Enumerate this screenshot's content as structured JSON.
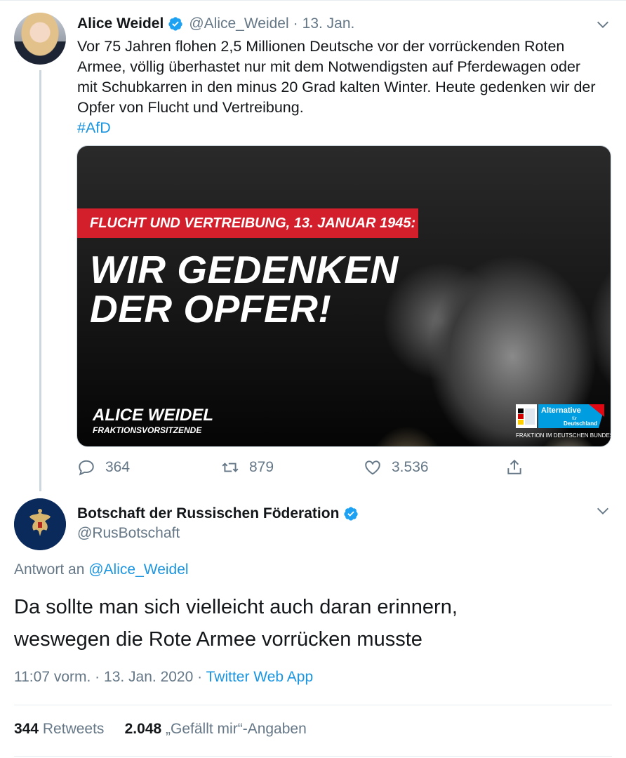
{
  "tweet1": {
    "name": "Alice Weidel",
    "handle": "@Alice_Weidel",
    "separator": "·",
    "date": "13. Jan.",
    "text": "Vor 75 Jahren flohen 2,5 Millionen Deutsche vor der vorrückenden Roten Armee, völlig überhastet nur mit dem Notwendigsten auf Pferdewagen oder mit Schubkarren in den minus 20 Grad kalten Winter. Heute gedenken wir der Opfer von Flucht und Vertreibung.",
    "hashtag": "#AfD",
    "media": {
      "banner": "FLUCHT UND VERTREIBUNG, 13. JANUAR 1945:",
      "headline_line1": "WIR GEDENKEN",
      "headline_line2": "DER OPFER!",
      "signature_name": "ALICE WEIDEL",
      "signature_role": "FRAKTIONSVORSITZENDE",
      "logo_text_1": "Alternative",
      "logo_text_2": "für",
      "logo_text_3": "Deutschland",
      "logo_caption": "FRAKTION IM DEUTSCHEN BUNDESTAG"
    },
    "actions": {
      "replies": "364",
      "retweets": "879",
      "likes": "3.536"
    }
  },
  "tweet2": {
    "name": "Botschaft der Russischen Föderation",
    "handle": "@RusBotschaft",
    "reply_prefix": "Antwort an",
    "reply_mention": "@Alice_Weidel",
    "text_line1": "Da sollte man sich vielleicht auch daran erinnern,",
    "text_line2": "weswegen die Rote Armee vorrücken musste",
    "time": "11:07 vorm.",
    "separator": "·",
    "date": "13. Jan. 2020",
    "app": "Twitter Web App",
    "retweets_count": "344",
    "retweets_label": "Retweets",
    "likes_count": "2.048",
    "likes_label": "„Gefällt mir“-Angaben"
  },
  "colors": {
    "link": "#1b95e0",
    "secondary_text": "#657786",
    "banner_red": "#d31f2c",
    "verified_blue": "#1da1f2"
  },
  "icons": [
    "verified-badge-icon",
    "chevron-down-icon",
    "reply-icon",
    "retweet-icon",
    "like-icon",
    "share-icon"
  ]
}
